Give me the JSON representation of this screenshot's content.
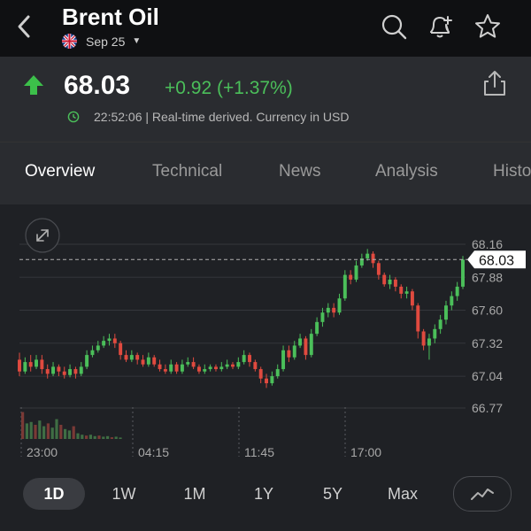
{
  "header": {
    "title": "Brent Oil",
    "contract": "Sep 25",
    "icons": [
      "back-chevron-icon",
      "search-icon",
      "bell-plus-icon",
      "star-icon"
    ]
  },
  "quote": {
    "price": "68.03",
    "change": "+0.92 (+1.37%)",
    "timestamp": "22:52:06 | Real-time derived. Currency in USD",
    "up_color": "#4bbf5a",
    "down_color": "#e04a3f"
  },
  "tabs": [
    {
      "label": "Overview"
    },
    {
      "label": "Technical"
    },
    {
      "label": "News"
    },
    {
      "label": "Analysis"
    },
    {
      "label": "Histo"
    }
  ],
  "chart_data": {
    "type": "candlestick",
    "y_ticks": [
      "68.16",
      "67.88",
      "67.60",
      "67.32",
      "67.04",
      "66.77"
    ],
    "ylim": [
      66.77,
      68.16
    ],
    "x_ticks": [
      "23:00",
      "04:15",
      "11:45",
      "17:00"
    ],
    "current_price_label": "68.03",
    "current_price": 68.03,
    "grid": true,
    "candles": [
      [
        67.18,
        67.08,
        67.24,
        67.04
      ],
      [
        67.08,
        67.16,
        67.2,
        67.06
      ],
      [
        67.16,
        67.12,
        67.22,
        67.08
      ],
      [
        67.12,
        67.18,
        67.22,
        67.1
      ],
      [
        67.18,
        67.1,
        67.22,
        67.06
      ],
      [
        67.1,
        67.06,
        67.14,
        67.02
      ],
      [
        67.06,
        67.12,
        67.16,
        67.04
      ],
      [
        67.12,
        67.08,
        67.14,
        67.04
      ],
      [
        67.08,
        67.05,
        67.12,
        67.02
      ],
      [
        67.05,
        67.1,
        67.14,
        67.03
      ],
      [
        67.1,
        67.06,
        67.12,
        67.02
      ],
      [
        67.06,
        67.12,
        67.16,
        67.04
      ],
      [
        67.12,
        67.22,
        67.26,
        67.1
      ],
      [
        67.22,
        67.26,
        67.3,
        67.2
      ],
      [
        67.26,
        67.3,
        67.34,
        67.24
      ],
      [
        67.3,
        67.34,
        67.38,
        67.28
      ],
      [
        67.34,
        67.36,
        67.4,
        67.3
      ],
      [
        67.36,
        67.32,
        67.4,
        67.28
      ],
      [
        67.32,
        67.22,
        67.34,
        67.18
      ],
      [
        67.22,
        67.18,
        67.26,
        67.16
      ],
      [
        67.18,
        67.22,
        67.26,
        67.16
      ],
      [
        67.22,
        67.18,
        67.24,
        67.14
      ],
      [
        67.18,
        67.14,
        67.22,
        67.12
      ],
      [
        67.14,
        67.2,
        67.24,
        67.12
      ],
      [
        67.2,
        67.14,
        67.22,
        67.12
      ],
      [
        67.14,
        67.1,
        67.18,
        67.08
      ],
      [
        67.1,
        67.08,
        67.14,
        67.06
      ],
      [
        67.08,
        67.14,
        67.18,
        67.06
      ],
      [
        67.14,
        67.08,
        67.16,
        67.06
      ],
      [
        67.08,
        67.14,
        67.18,
        67.06
      ],
      [
        67.14,
        67.16,
        67.2,
        67.12
      ],
      [
        67.16,
        67.12,
        67.2,
        67.1
      ],
      [
        67.12,
        67.08,
        67.14,
        67.06
      ],
      [
        67.08,
        67.1,
        67.14,
        67.06
      ],
      [
        67.1,
        67.12,
        67.14,
        67.08
      ],
      [
        67.12,
        67.1,
        67.14,
        67.08
      ],
      [
        67.1,
        67.12,
        67.16,
        67.08
      ],
      [
        67.12,
        67.14,
        67.18,
        67.1
      ],
      [
        67.14,
        67.12,
        67.16,
        67.1
      ],
      [
        67.12,
        67.16,
        67.2,
        67.1
      ],
      [
        67.16,
        67.22,
        67.26,
        67.14
      ],
      [
        67.22,
        67.16,
        67.24,
        67.12
      ],
      [
        67.16,
        67.1,
        67.18,
        67.08
      ],
      [
        67.1,
        67.02,
        67.12,
        66.98
      ],
      [
        67.02,
        66.98,
        67.06,
        66.94
      ],
      [
        66.98,
        67.04,
        67.08,
        66.96
      ],
      [
        67.04,
        67.1,
        67.14,
        67.02
      ],
      [
        67.1,
        67.26,
        67.3,
        67.08
      ],
      [
        67.26,
        67.2,
        67.3,
        67.16
      ],
      [
        67.2,
        67.3,
        67.34,
        67.18
      ],
      [
        67.3,
        67.36,
        67.4,
        67.28
      ],
      [
        67.36,
        67.22,
        67.38,
        67.18
      ],
      [
        67.22,
        67.4,
        67.44,
        67.2
      ],
      [
        67.4,
        67.5,
        67.54,
        67.38
      ],
      [
        67.5,
        67.58,
        67.62,
        67.46
      ],
      [
        67.58,
        67.62,
        67.66,
        67.54
      ],
      [
        67.62,
        67.58,
        67.66,
        67.54
      ],
      [
        67.58,
        67.7,
        67.74,
        67.56
      ],
      [
        67.7,
        67.9,
        67.94,
        67.68
      ],
      [
        67.9,
        67.86,
        67.94,
        67.82
      ],
      [
        67.86,
        67.98,
        68.02,
        67.84
      ],
      [
        67.98,
        68.04,
        68.08,
        67.96
      ],
      [
        68.04,
        68.08,
        68.12,
        68.02
      ],
      [
        68.08,
        68.0,
        68.1,
        67.96
      ],
      [
        68.0,
        67.9,
        68.02,
        67.86
      ],
      [
        67.9,
        67.82,
        67.92,
        67.8
      ],
      [
        67.82,
        67.86,
        67.9,
        67.78
      ],
      [
        67.86,
        67.8,
        67.88,
        67.76
      ],
      [
        67.8,
        67.74,
        67.82,
        67.7
      ],
      [
        67.74,
        67.76,
        67.8,
        67.7
      ],
      [
        67.76,
        67.64,
        67.78,
        67.6
      ],
      [
        67.64,
        67.42,
        67.66,
        67.36
      ],
      [
        67.42,
        67.3,
        67.44,
        67.26
      ],
      [
        67.3,
        67.36,
        67.4,
        67.18
      ],
      [
        67.36,
        67.44,
        67.48,
        67.32
      ],
      [
        67.44,
        67.52,
        67.56,
        67.4
      ],
      [
        67.52,
        67.64,
        67.68,
        67.48
      ],
      [
        67.64,
        67.72,
        67.76,
        67.6
      ],
      [
        67.72,
        67.8,
        67.84,
        67.68
      ],
      [
        67.8,
        68.03,
        68.06,
        67.78
      ]
    ],
    "volume": [
      0.95,
      0.55,
      0.6,
      0.5,
      0.65,
      0.45,
      0.55,
      0.4,
      0.7,
      0.5,
      0.35,
      0.3,
      0.45,
      0.2,
      0.15,
      0.12,
      0.15,
      0.1,
      0.12,
      0.08,
      0.1,
      0.06,
      0.08,
      0.05
    ]
  },
  "ranges": [
    {
      "label": "1D"
    },
    {
      "label": "1W"
    },
    {
      "label": "1M"
    },
    {
      "label": "1Y"
    },
    {
      "label": "5Y"
    },
    {
      "label": "Max"
    }
  ]
}
